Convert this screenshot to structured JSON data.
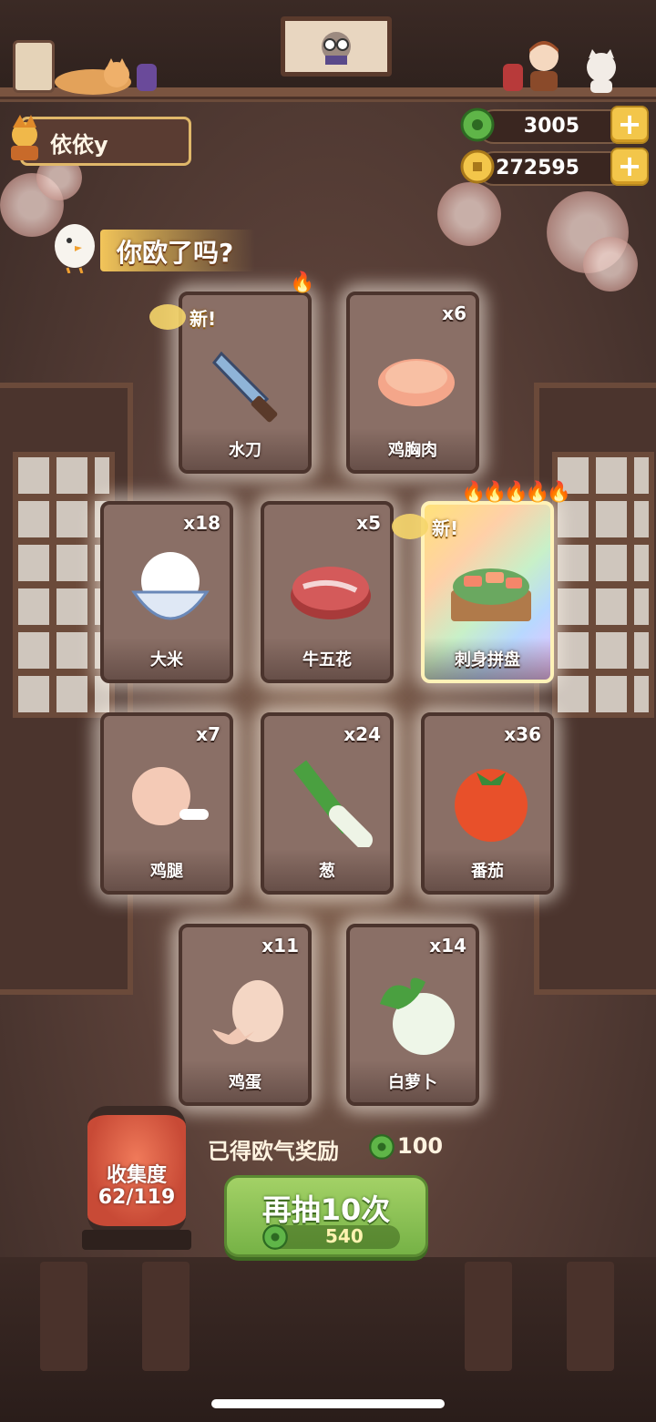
{
  "header": {
    "player_name": "依依y"
  },
  "currencies": {
    "jade": {
      "icon": "jade-coin-icon",
      "value": "3005"
    },
    "gold": {
      "icon": "gold-coin-icon",
      "value": "272595"
    },
    "plus_symbol": "+"
  },
  "draw_result": {
    "title": "你欧了吗?",
    "new_label": "新!",
    "cards": [
      {
        "name": "水刀",
        "count": "",
        "is_new": true,
        "flames": 1,
        "rarity": "normal",
        "icon": "water-knife-icon"
      },
      {
        "name": "鸡胸肉",
        "count": "x6",
        "is_new": false,
        "flames": 0,
        "rarity": "normal",
        "icon": "chicken-breast-icon"
      },
      {
        "name": "大米",
        "count": "x18",
        "is_new": false,
        "flames": 0,
        "rarity": "normal",
        "icon": "rice-bowl-icon"
      },
      {
        "name": "牛五花",
        "count": "x5",
        "is_new": false,
        "flames": 0,
        "rarity": "normal",
        "icon": "beef-brisket-icon"
      },
      {
        "name": "刺身拼盘",
        "count": "",
        "is_new": true,
        "flames": 5,
        "rarity": "legendary",
        "icon": "sashimi-platter-icon"
      },
      {
        "name": "鸡腿",
        "count": "x7",
        "is_new": false,
        "flames": 0,
        "rarity": "normal",
        "icon": "chicken-leg-icon"
      },
      {
        "name": "葱",
        "count": "x24",
        "is_new": false,
        "flames": 0,
        "rarity": "normal",
        "icon": "scallion-icon"
      },
      {
        "name": "番茄",
        "count": "x36",
        "is_new": false,
        "flames": 0,
        "rarity": "normal",
        "icon": "tomato-icon"
      },
      {
        "name": "鸡蛋",
        "count": "x11",
        "is_new": false,
        "flames": 0,
        "rarity": "normal",
        "icon": "egg-icon"
      },
      {
        "name": "白萝卜",
        "count": "x14",
        "is_new": false,
        "flames": 0,
        "rarity": "normal",
        "icon": "daikon-icon"
      }
    ]
  },
  "collection": {
    "label": "收集度",
    "progress": "62/119"
  },
  "reward": {
    "label": "已得欧气奖励",
    "icon": "jade-coin-icon",
    "value": "100"
  },
  "draw_button": {
    "label": "再抽10次",
    "cost_icon": "jade-coin-icon",
    "cost": "540"
  },
  "colors": {
    "accent_gold": "#f3c64a",
    "button_green": "#76b246",
    "card_bg": "#8a6f66",
    "lantern_red": "#c84a36"
  }
}
